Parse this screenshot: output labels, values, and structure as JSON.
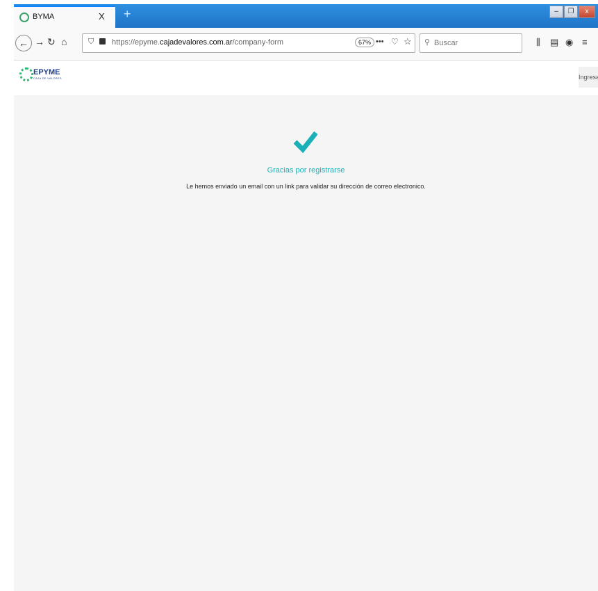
{
  "browser": {
    "tab_title": "BYMA",
    "tab_close": "X",
    "new_tab": "+",
    "window_buttons": {
      "minimize": "–",
      "restore": "❐",
      "close": "x"
    },
    "url_prefix": "https://epyme.",
    "url_domain": "cajadevalores.com.ar",
    "url_path": "/company-form",
    "zoom": "67%",
    "search_placeholder": "Buscar"
  },
  "site": {
    "logo_text": "EPYME",
    "logo_subtext": "CAJA DE VALORES",
    "login_label": "Ingresar"
  },
  "confirmation": {
    "title": "Gracias por registrarse",
    "message": "Le hemos enviado un email con un link para validar su dirección de correo electronico.",
    "check_color": "#1bb0b7"
  }
}
